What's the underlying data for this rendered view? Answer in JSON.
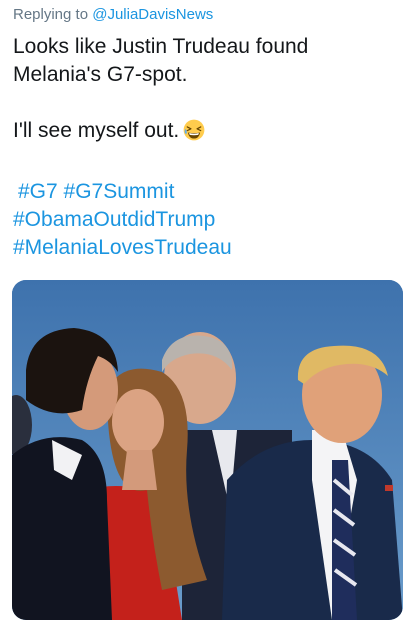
{
  "reply": {
    "prefix": "Replying to ",
    "handle": "@JuliaDavisNews"
  },
  "tweet": {
    "line1": "Looks like Justin Trudeau found",
    "line2": "Melania's G7-spot.",
    "line3": "I'll see myself out.",
    "emoji": "grinning-squinting-face-emoji"
  },
  "hashtags": {
    "tag1": "#G7",
    "tag2": "#G7Summit",
    "tag3": "#ObamaOutdidTrump",
    "tag4": "#MelaniaLovesTrudeau"
  },
  "colors": {
    "link": "#1b95e0",
    "text": "#14171a",
    "muted": "#657786"
  }
}
